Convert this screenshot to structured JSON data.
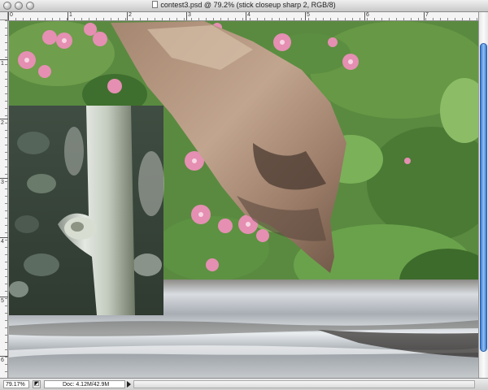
{
  "window": {
    "title": "contest3.psd @ 79.2% (stick closeup sharp 2, RGB/8)"
  },
  "rulers": {
    "horizontal_labels": [
      "0",
      "1",
      "2",
      "3",
      "4",
      "5",
      "6",
      "7"
    ],
    "vertical_labels": [
      "1",
      "2",
      "3",
      "4",
      "5",
      "6"
    ]
  },
  "statusbar": {
    "zoom": "79.17%",
    "doc_info": "Doc: 4.12M/42.9M"
  },
  "colors": {
    "scroll_thumb": "#3c79d0",
    "flower_pink": "#e58fb2",
    "foliage_green": "#4f7d39"
  },
  "icons": {
    "close": "close-icon",
    "minimize": "minimize-icon",
    "zoom": "zoom-icon",
    "document": "document-icon",
    "status_menu": "triangle-right-icon"
  }
}
